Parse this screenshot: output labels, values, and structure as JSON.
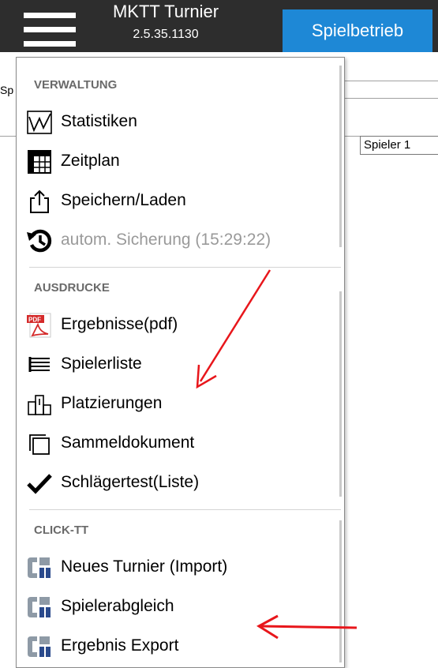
{
  "header": {
    "app_title": "MKTT Turnier",
    "version": "2.5.35.1130",
    "tab_label": "Spielbetrieb"
  },
  "background": {
    "left_fragment": "Sp",
    "column_header": "Spieler 1"
  },
  "menu": {
    "sections": [
      {
        "title": "VERWALTUNG",
        "items": [
          {
            "label": "Statistiken",
            "icon": "chart-line-icon",
            "enabled": true
          },
          {
            "label": "Zeitplan",
            "icon": "grid-table-icon",
            "enabled": true
          },
          {
            "label": "Speichern/Laden",
            "icon": "share-upload-icon",
            "enabled": true
          },
          {
            "label": "autom. Sicherung (15:29:22)",
            "icon": "history-clock-icon",
            "enabled": false
          }
        ]
      },
      {
        "title": "AUSDRUCKE",
        "items": [
          {
            "label": "Ergebnisse(pdf)",
            "icon": "pdf-icon",
            "enabled": true
          },
          {
            "label": "Spielerliste",
            "icon": "list-icon",
            "enabled": true
          },
          {
            "label": "Platzierungen",
            "icon": "podium-icon",
            "enabled": true
          },
          {
            "label": "Sammeldokument",
            "icon": "copy-documents-icon",
            "enabled": true
          },
          {
            "label": "Schlägertest(Liste)",
            "icon": "checkmark-icon",
            "enabled": true
          }
        ]
      },
      {
        "title": "CLICK-TT",
        "items": [
          {
            "label": "Neues Turnier (Import)",
            "icon": "click-tt-logo-icon",
            "enabled": true
          },
          {
            "label": "Spielerabgleich",
            "icon": "click-tt-logo-icon",
            "enabled": true
          },
          {
            "label": "Ergebnis Export",
            "icon": "click-tt-logo-icon",
            "enabled": true
          }
        ]
      }
    ]
  },
  "colors": {
    "topbar": "#2d2d2d",
    "accent_tab": "#1e88d6",
    "annotation_arrow": "#e8161b",
    "clicktt_blue": "#2a4a8c",
    "clicktt_grey": "#8e9aa6"
  }
}
